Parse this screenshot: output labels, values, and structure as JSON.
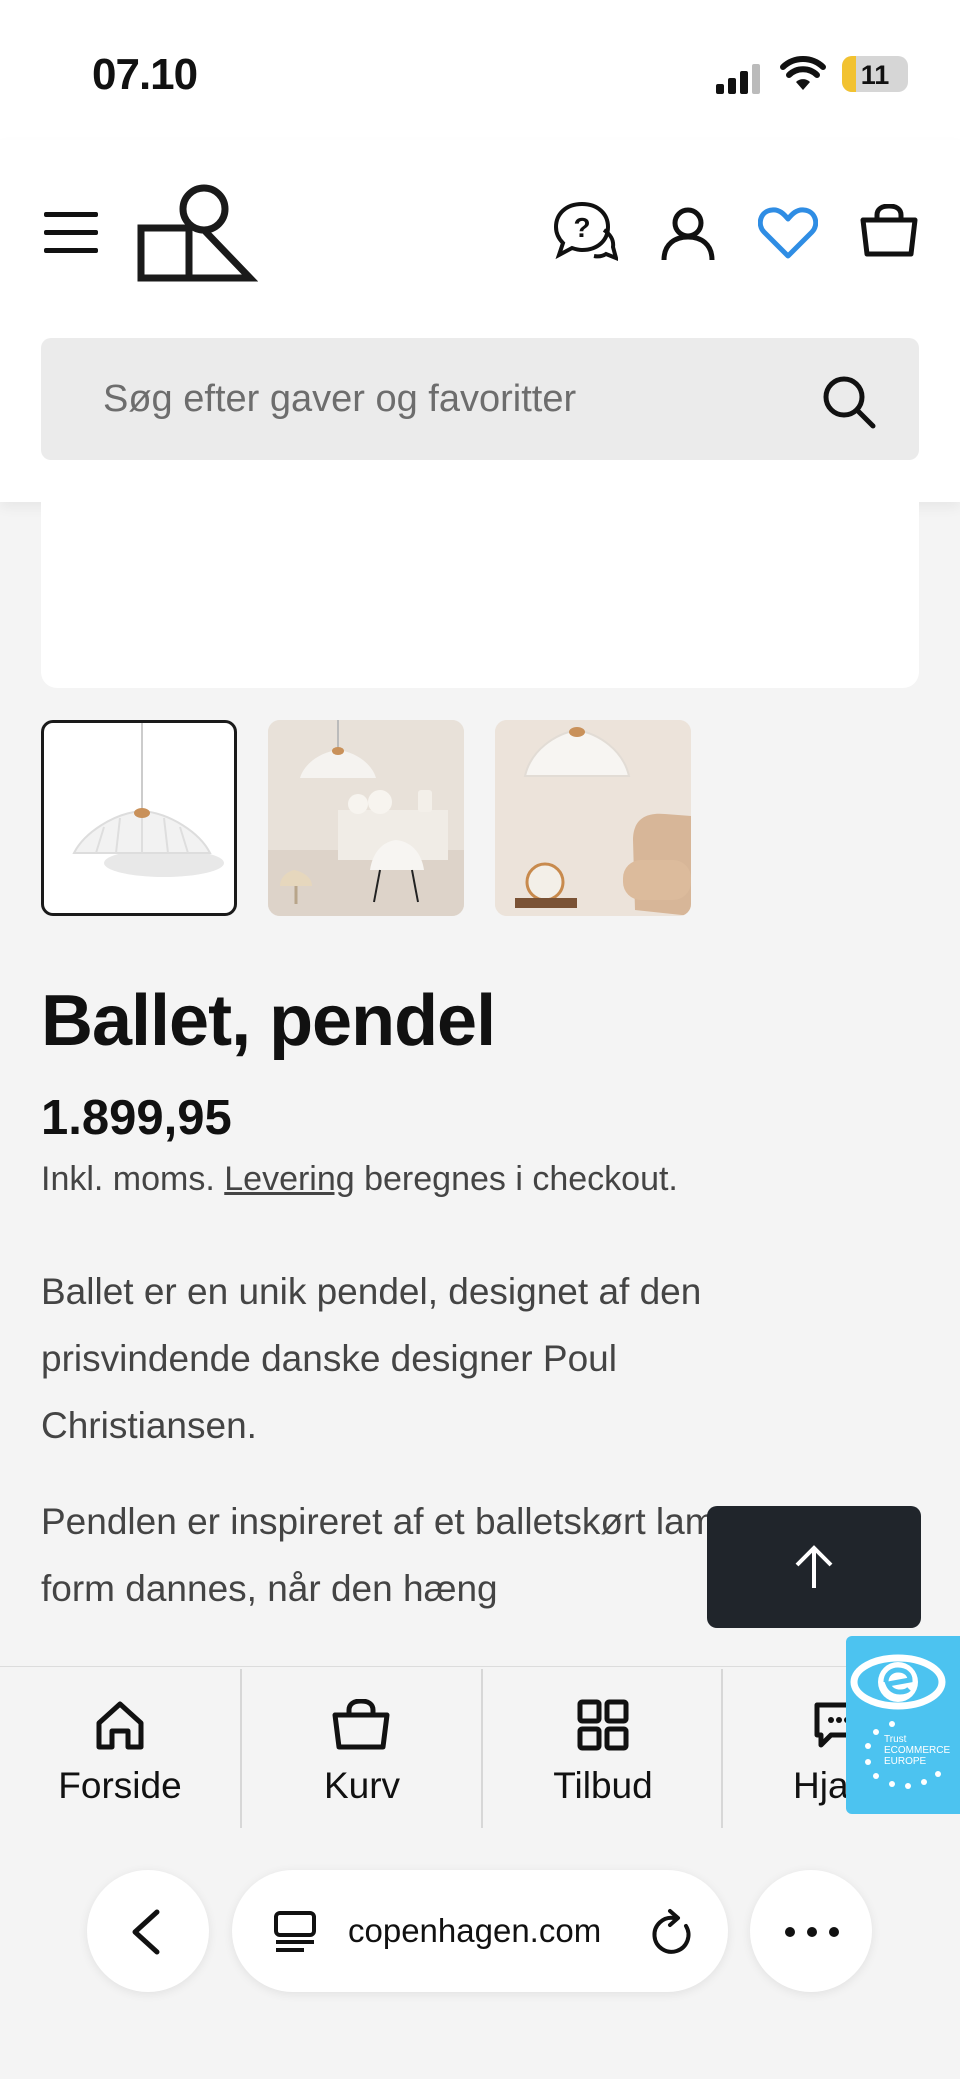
{
  "status_bar": {
    "time": "07.10",
    "battery": "11"
  },
  "header": {
    "search": {
      "placeholder": "Søg efter gaver og favoritter"
    }
  },
  "product": {
    "title": "Ballet, pendel",
    "price": "1.899,95",
    "tax_prefix": "Inkl. moms. ",
    "tax_link": "Levering",
    "tax_suffix": " beregnes i checkout.",
    "description": [
      "Ballet er en unik pendel, designet af den prisvindende danske designer Poul Christiansen.",
      "Pendlen er inspireret af et balletskørt lampens form dannes, når den hæng"
    ]
  },
  "bottom_nav": [
    {
      "label": "Forside",
      "icon": "home-icon"
    },
    {
      "label": "Kurv",
      "icon": "bag-icon"
    },
    {
      "label": "Tilbud",
      "icon": "grid-icon"
    },
    {
      "label": "Hja",
      "icon": "chat-icon"
    }
  ],
  "browser": {
    "url": "copenhagen.com"
  },
  "badge": {
    "lines": [
      "Trust",
      "ECOMMERCE",
      "EUROPE"
    ]
  },
  "colors": {
    "accent_heart": "#2f8de4",
    "dark_button": "#20252b",
    "trust_badge": "#4cc3f0"
  }
}
